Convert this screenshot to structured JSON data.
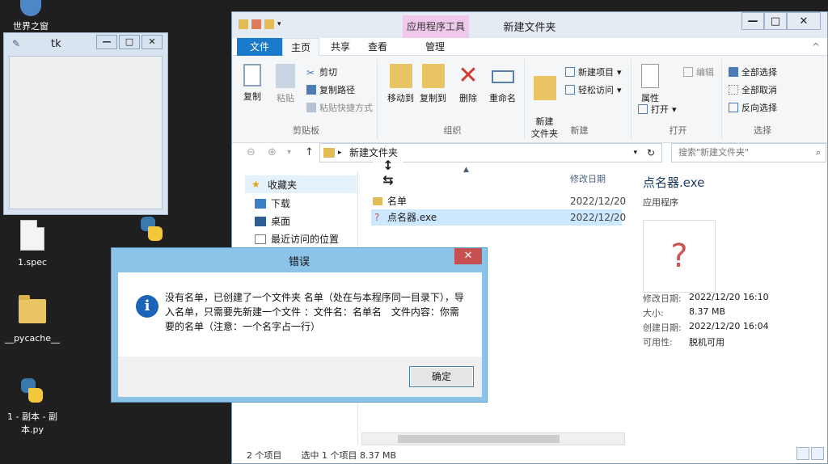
{
  "desktop": {
    "icons": [
      {
        "label": "世界之窗"
      },
      {
        "label": "1.spec"
      },
      {
        "label": "__pycache__"
      },
      {
        "label": "1 - 副本 - 副本.py"
      }
    ]
  },
  "tk_window": {
    "title": "tk"
  },
  "explorer": {
    "title": "新建文件夹",
    "context_tab": "应用程序工具",
    "tabs": [
      "文件",
      "主页",
      "共享",
      "查看",
      "管理"
    ],
    "ribbon": {
      "clipboard": {
        "copy": "复制",
        "paste": "粘贴",
        "cut": "剪切",
        "copy_path": "复制路径",
        "paste_shortcut": "粘贴快捷方式",
        "label": "剪贴板"
      },
      "organize": {
        "move_to": "移动到",
        "copy_to": "复制到",
        "delete": "删除",
        "rename": "重命名",
        "label": "组织"
      },
      "new": {
        "new_folder": "新建\n文件夹",
        "new_item": "新建项目",
        "easy_access": "轻松访问",
        "label": "新建"
      },
      "open": {
        "properties": "属性",
        "open": "打开",
        "edit": "编辑",
        "label": "打开"
      },
      "select": {
        "select_all": "全部选择",
        "select_none": "全部取消",
        "invert": "反向选择",
        "label": "选择"
      }
    },
    "address": "新建文件夹",
    "search_placeholder": "搜索\"新建文件夹\"",
    "nav": {
      "favorites": "收藏夹",
      "downloads": "下载",
      "desktop": "桌面",
      "recent": "最近访问的位置"
    },
    "columns": {
      "date": "修改日期"
    },
    "files": [
      {
        "name": "名单",
        "date": "2022/12/20"
      },
      {
        "name": "点名器.exe",
        "date": "2022/12/20"
      }
    ],
    "details": {
      "name": "点名器.exe",
      "type": "应用程序",
      "props": [
        {
          "k": "修改日期:",
          "v": "2022/12/20 16:10"
        },
        {
          "k": "大小:",
          "v": "8.37 MB"
        },
        {
          "k": "创建日期:",
          "v": "2022/12/20 16:04"
        },
        {
          "k": "可用性:",
          "v": "脱机可用"
        }
      ]
    },
    "status": {
      "count": "2 个项目",
      "selected": "选中 1 个项目  8.37 MB"
    }
  },
  "dialog": {
    "title": "错误",
    "message": "没有名单，已创建了一个文件夹 名单（处在与本程序同一目录下），导入名单，只需要先新建一个文件 ：文件名：名单名　文件内容：你需要的名单（注意：一个名字占一行）",
    "ok": "确定"
  },
  "colors": {
    "accent": "#1979ca",
    "dialog_frame": "#8cc3e8",
    "close": "#c75050",
    "info": "#1c64b7"
  }
}
